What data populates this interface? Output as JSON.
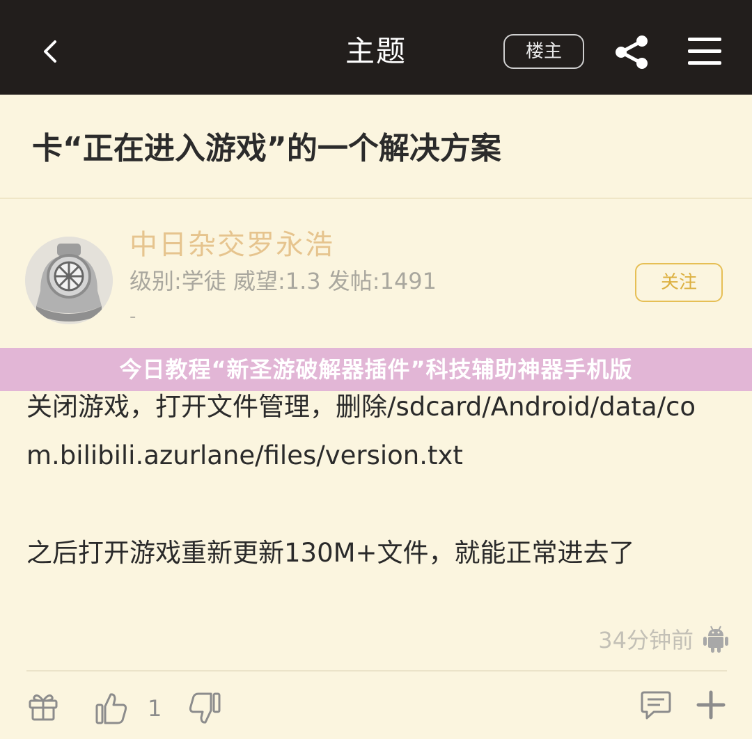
{
  "header": {
    "title": "主题",
    "op_label": "楼主"
  },
  "thread": {
    "title": "卡“正在进入游戏”的一个解决方案"
  },
  "author": {
    "name": "中日杂交罗永浩",
    "stats": "级别:学徒 威望:1.3 发帖:1491",
    "signature": "-",
    "follow_label": "关注"
  },
  "banner": {
    "text": "今日教程“新圣游破解器插件”科技辅助神器手机版"
  },
  "post": {
    "paragraph1": "关闭游戏，打开文件管理，删除/sdcard/Android/data/com.bilibili.azurlane/files/version.txt",
    "paragraph2": "之后打开游戏重新更新130M+文件，就能正常进去了",
    "time": "34分钟前"
  },
  "actions": {
    "like_count": "1"
  },
  "colors": {
    "header_bg": "#221e1c",
    "page_bg": "#fbf5df",
    "username": "#e6c48e",
    "follow_accent": "#dcb040",
    "banner_bg": "#e2b6d6"
  },
  "icons": [
    "back-icon",
    "share-icon",
    "menu-icon",
    "android-icon",
    "gift-icon",
    "thumbs-up-icon",
    "thumbs-down-icon",
    "comment-icon",
    "plus-icon"
  ]
}
